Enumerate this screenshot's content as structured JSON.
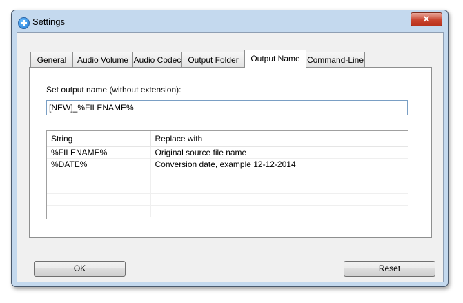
{
  "window": {
    "title": "Settings",
    "close_label": "✕"
  },
  "tabs": [
    {
      "label": "General"
    },
    {
      "label": "Audio Volume"
    },
    {
      "label": "Audio Codec"
    },
    {
      "label": "Output Folder"
    },
    {
      "label": "Output Name",
      "active": true
    },
    {
      "label": "Command-Line"
    }
  ],
  "output_name": {
    "label": "Set output name (without extension):",
    "value": "[NEW]_%FILENAME%"
  },
  "table": {
    "columns": [
      "String",
      "Replace with"
    ],
    "rows": [
      [
        "%FILENAME%",
        "Original source file name"
      ],
      [
        "%DATE%",
        "Conversion date, example 12-12-2014"
      ]
    ]
  },
  "buttons": {
    "ok": "OK",
    "reset": "Reset"
  }
}
